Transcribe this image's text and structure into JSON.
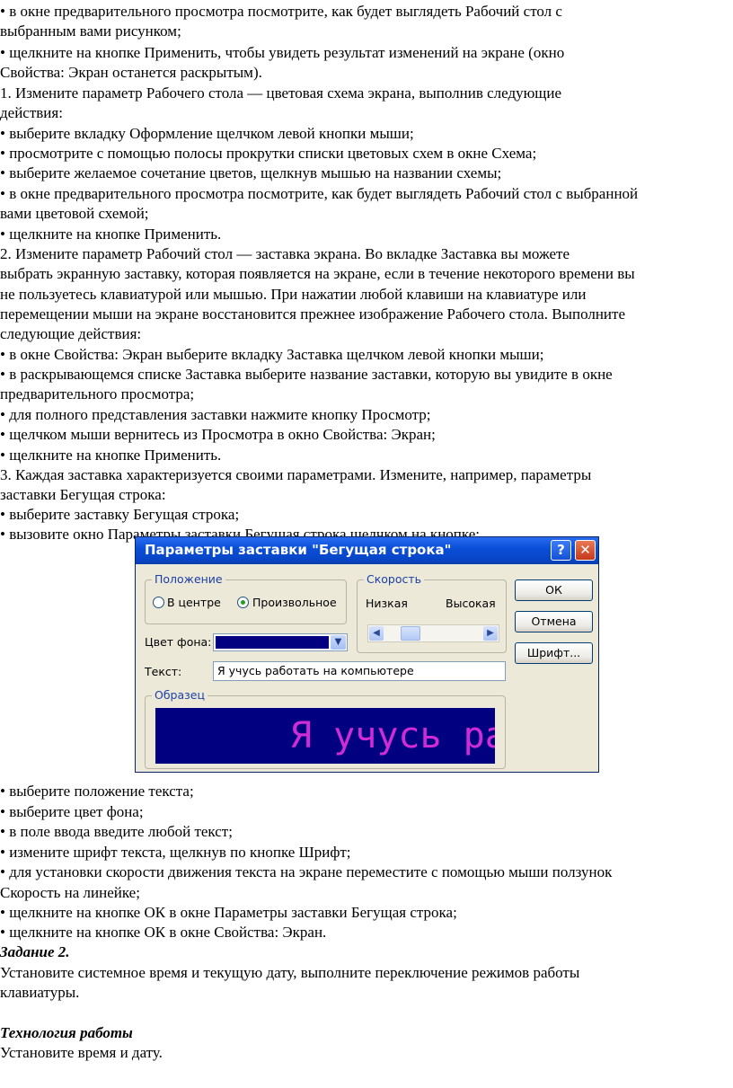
{
  "lines": [
    "• в окне предварительного просмотра посмотрите, как будет выглядеть Рабочий стол с",
    "выбранным вами рисунком;",
    "• щелкните на кнопке Применить, чтобы увидеть результат изменений на экране (окно",
    "Свойства: Экран останется раскрытым).",
    "1. Измените параметр Рабочего стола — цветовая схема экрана, выполнив следующие",
    "действия:",
    "• выберите вкладку Оформление щелчком левой кнопки мыши;",
    "• просмотрите с помощью полосы прокрутки списки цветовых схем в окне Схема;",
    "• выберите желаемое сочетание цветов, щелкнув мышью на названии схемы;",
    "• в окне предварительного просмотра посмотрите, как будет выглядеть Рабочий стол с выбранной",
    "вами цветовой схемой;",
    "• щелкните на кнопке Применить.",
    "2. Измените параметр Рабочий стол — заставка экрана. Во вкладке Заставка вы можете",
    "выбрать экранную заставку, которая появляется на экране, если в течение некоторого времени вы",
    "не пользуетесь клавиатурой или мышью. При нажатии любой клавиши на клавиатуре или",
    "перемещении мыши на экране восстановится прежнее изображение Рабочего стола. Выполните",
    "следующие действия:",
    "• в окне Свойства: Экран выберите вкладку Заставка щелчком левой кнопки мыши;",
    "• в раскрывающемся списке Заставка выберите название заставки, которую вы увидите в окне",
    "предварительного просмотра;",
    "• для полного представления заставки нажмите кнопку Просмотр;",
    "• щелчком мыши вернитесь из Просмотра в окно Свойства: Экран;",
    "• щелкните на кнопке Применить.",
    "3. Каждая заставка характеризуется своими параметрами. Измените, например, параметры",
    "заставки Бегущая строка:",
    "• выберите заставку Бегущая строка;",
    "• вызовите окно Параметры заставки Бегущая строка щелчком на кнопке;"
  ],
  "lines_after": [
    "• выберите положение текста;",
    "• выберите цвет фона;",
    "• в поле ввода введите любой текст;",
    "• измените шрифт текста, щелкнув по кнопке Шрифт;",
    "• для установки скорости движения текста на экране переместите с помощью мыши ползунок",
    "Скорость на линейке;",
    "• щелкните на кнопке ОК в окне Параметры заставки Бегущая строка;",
    "• щелкните на кнопке ОК в окне Свойства: Экран.",
    "Задание 2.",
    "Установите системное время и текущую дату, выполните переключение режимов работы",
    "клавиатуры.",
    "",
    "Технология работы",
    "Установите время и дату."
  ],
  "dialog": {
    "title": "Параметры заставки \"Бегущая строка\"",
    "help_glyph": "?",
    "close_glyph": "✕",
    "position_group": "Положение",
    "radio_center": "В центре",
    "radio_random": "Произвольное",
    "speed_group": "Скорость",
    "speed_low": "Низкая",
    "speed_high": "Высокая",
    "speed_level": 0.2,
    "bg_color_label": "Цвет фона:",
    "bg_color": "#000080",
    "text_label": "Текст:",
    "text_value": "Я учусь работать на компьютере",
    "sample_group": "Образец",
    "sample_text": "Я учусь раб",
    "sample_color": "#d02bd6",
    "ok": "ОК",
    "cancel": "Отмена",
    "font": "Шрифт..."
  }
}
